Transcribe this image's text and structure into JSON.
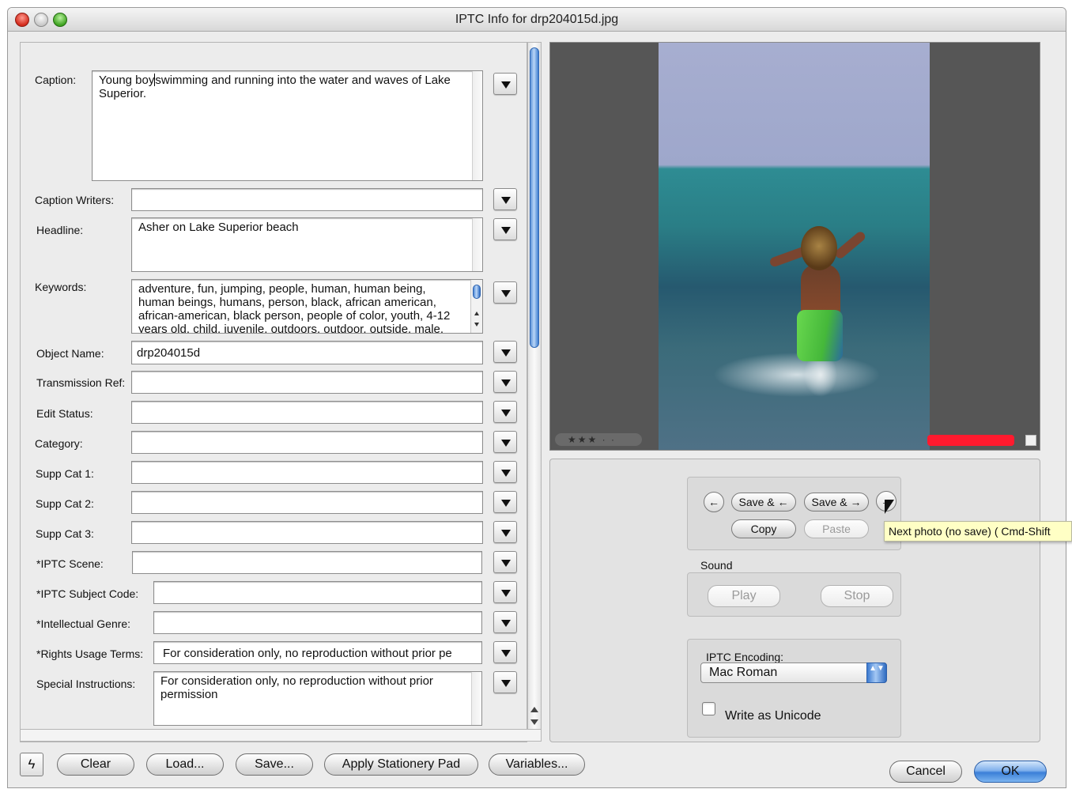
{
  "window": {
    "title": "IPTC Info for drp204015d.jpg"
  },
  "form": {
    "caption": {
      "label": "Caption:",
      "value_before_caret": "Young boy",
      "value_after_caret": "swimming and running into the water and waves of Lake Superior."
    },
    "caption_writers": {
      "label": "Caption Writers:",
      "value": ""
    },
    "headline": {
      "label": "Headline:",
      "value": "Asher on Lake Superior beach"
    },
    "keywords": {
      "label": "Keywords:",
      "value": "adventure, fun, jumping, people, human, human being, human beings, humans, person, black, african american, african-american, black person, people of color, youth, 4-12 years old, child, juvenile, outdoors, outdoor, outside, male, masculine,"
    },
    "object_name": {
      "label": "Object Name:",
      "value": "drp204015d"
    },
    "transmission_ref": {
      "label": "Transmission Ref:",
      "value": ""
    },
    "edit_status": {
      "label": "Edit Status:",
      "value": ""
    },
    "category": {
      "label": "Category:",
      "value": ""
    },
    "supp_cat_1": {
      "label": "Supp Cat 1:",
      "value": ""
    },
    "supp_cat_2": {
      "label": "Supp Cat 2:",
      "value": ""
    },
    "supp_cat_3": {
      "label": "Supp Cat 3:",
      "value": ""
    },
    "iptc_scene": {
      "label": "*IPTC Scene:",
      "value": ""
    },
    "iptc_subject_code": {
      "label": "*IPTC Subject Code:",
      "value": ""
    },
    "intellectual_genre": {
      "label": "*Intellectual Genre:",
      "value": ""
    },
    "rights_usage_terms": {
      "label": "*Rights Usage Terms:",
      "value": "For consideration only, no reproduction without prior pe"
    },
    "special_instructions": {
      "label": "Special Instructions:",
      "value": "For consideration only, no reproduction without prior permission"
    }
  },
  "preview": {
    "rating": "★★★ · ·",
    "rating_count": 3,
    "label_color": "#ff1a2e"
  },
  "navigation": {
    "prev_glyph": "←",
    "save_prev": "Save & ←",
    "save_next": "Save & →",
    "next_glyph": "→",
    "copy": "Copy",
    "paste": "Paste",
    "tooltip": "Next photo (no save) ( Cmd-Shift"
  },
  "sound": {
    "title": "Sound",
    "play": "Play",
    "stop": "Stop"
  },
  "encoding": {
    "title": "IPTC Encoding:",
    "selected": "Mac Roman",
    "stepper_glyph": "▲▼",
    "unicode_label": "Write as Unicode",
    "unicode_checked": false
  },
  "toolbar": {
    "bolt": "ϟ",
    "clear": "Clear",
    "load": "Load...",
    "save": "Save...",
    "apply_stationery": "Apply Stationery Pad",
    "variables": "Variables...",
    "cancel": "Cancel",
    "ok": "OK"
  },
  "colors": {
    "accent": "#3b7fd8",
    "window_bg": "#ececec",
    "preview_bg": "#565656",
    "tooltip_bg": "#ffffc5"
  }
}
